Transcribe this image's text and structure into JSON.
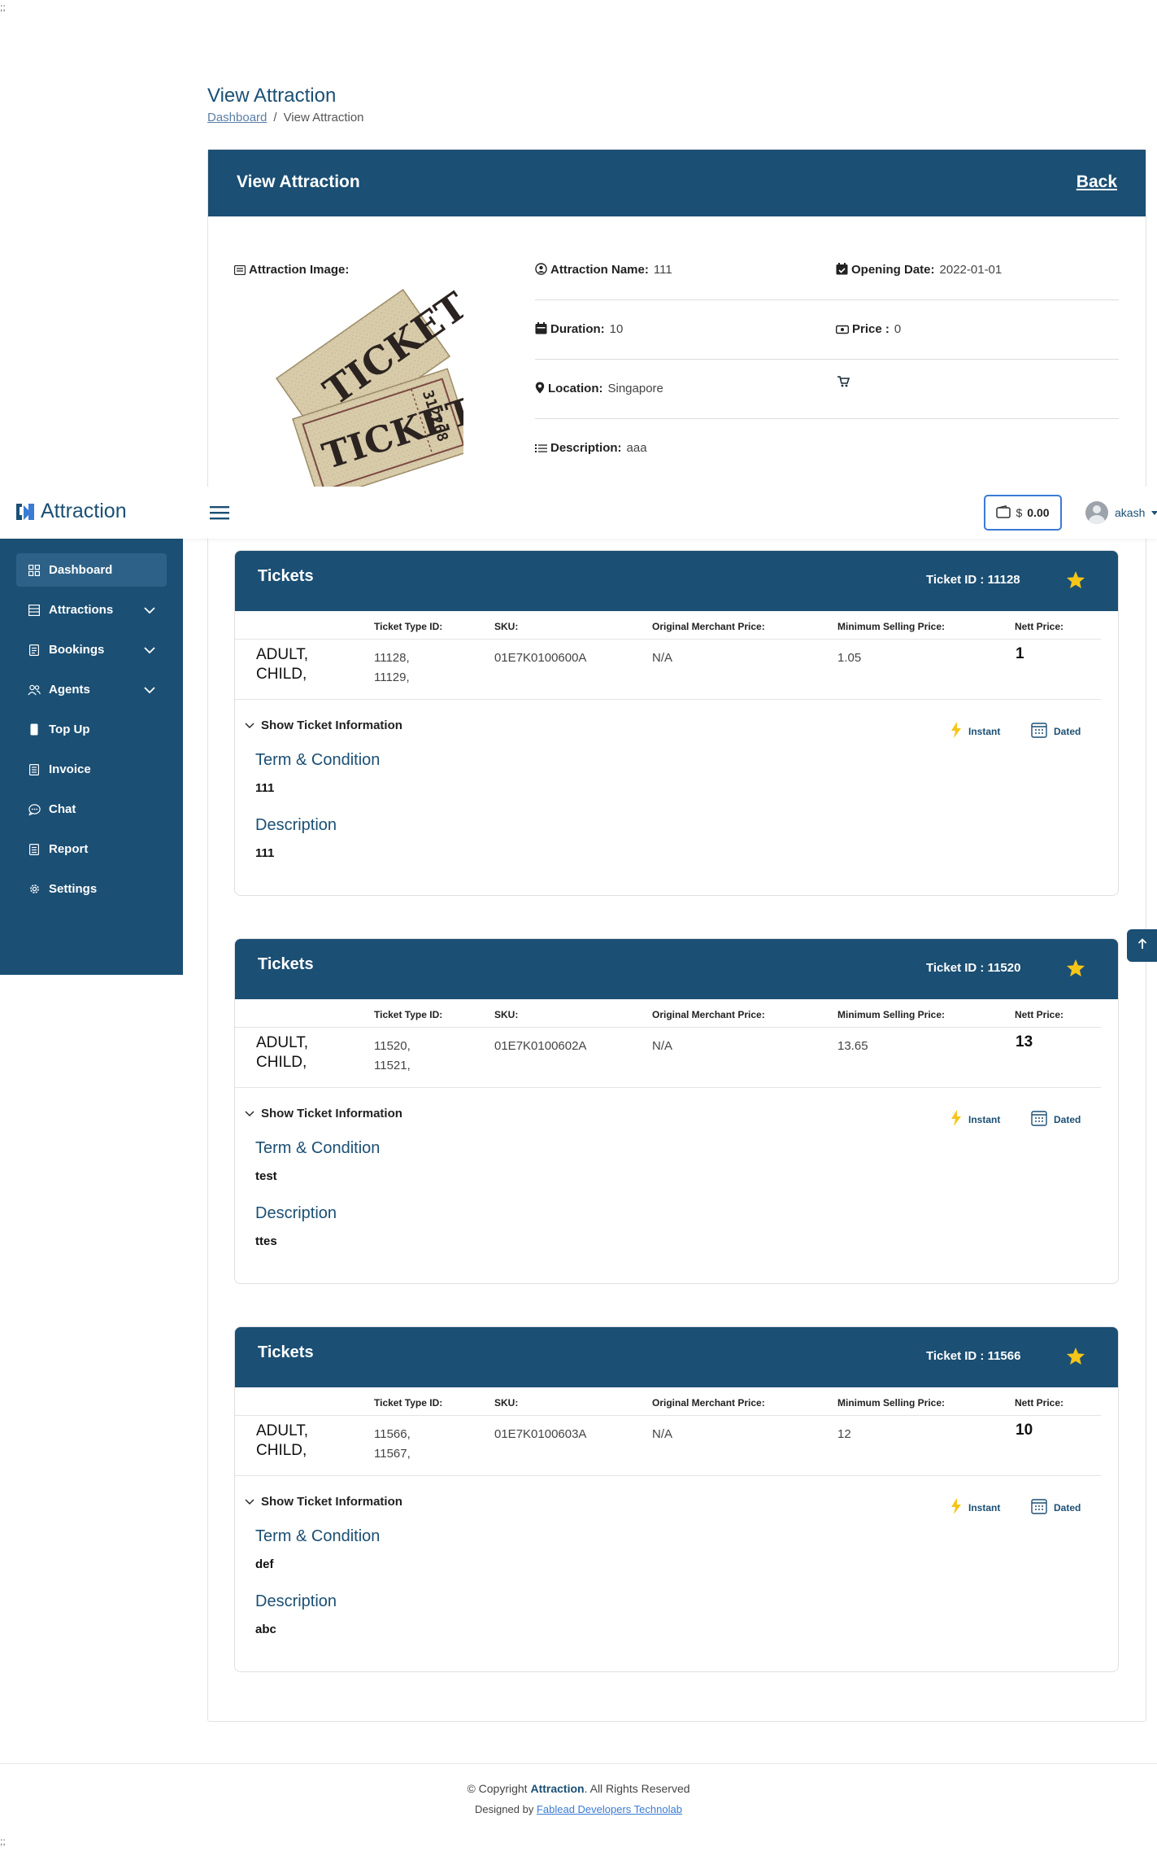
{
  "corner": {
    "top_left": ";;",
    "bottom_left": ";;"
  },
  "page": {
    "title": "View Attraction",
    "breadcrumb": {
      "home": "Dashboard",
      "separator": "/",
      "current": "View Attraction"
    }
  },
  "card": {
    "title": "View Attraction",
    "back_label": "Back"
  },
  "details": {
    "image_label": "Attraction Image:",
    "name_label": "Attraction Name:",
    "name_value": "111",
    "opening_label": "Opening Date:",
    "opening_value": "2022-01-01",
    "duration_label": "Duration:",
    "duration_value": "10",
    "price_label": "Price :",
    "price_value": "0",
    "location_label": "Location:",
    "location_value": "Singapore",
    "description_label": "Description:",
    "description_value": "aaa",
    "ticket_img_serial": "312268",
    "ticket_img_text": "TICKET"
  },
  "navbar": {
    "brand": "Attraction",
    "wallet_currency": "$",
    "wallet_amount": "0.00",
    "user": "akash"
  },
  "sidebar": {
    "items": [
      {
        "label": "Dashboard",
        "icon": "grid-icon"
      },
      {
        "label": "Attractions",
        "icon": "list-icon"
      },
      {
        "label": "Bookings",
        "icon": "document-icon"
      },
      {
        "label": "Agents",
        "icon": "users-icon"
      },
      {
        "label": "Top Up",
        "icon": "mobile-icon"
      },
      {
        "label": "Invoice",
        "icon": "invoice-icon"
      },
      {
        "label": "Chat",
        "icon": "chat-icon"
      },
      {
        "label": "Report",
        "icon": "report-icon"
      },
      {
        "label": "Settings",
        "icon": "gear-icon"
      }
    ]
  },
  "tickets_common": {
    "title": "Tickets",
    "columns": [
      "Ticket Type ID:",
      "SKU:",
      "Original Merchant Price:",
      "Minimum Selling Price:",
      "Nett Price:"
    ],
    "show_info": "Show Ticket Information",
    "instant": "Instant",
    "dated": "Dated",
    "term_title": "Term & Condition",
    "desc_title": "Description"
  },
  "tickets": [
    {
      "ticket_id": "Ticket ID : 11128",
      "type_line1": "ADULT,",
      "type_line2": "CHILD,",
      "id_line1": "11128,",
      "id_line2": "11129,",
      "sku": "01E7K0100600A",
      "merchant_price": "N/A",
      "min_price": "1.05",
      "nett": "1",
      "term": "111",
      "description": "111"
    },
    {
      "ticket_id": "Ticket ID : 11520",
      "type_line1": "ADULT,",
      "type_line2": "CHILD,",
      "id_line1": "11520,",
      "id_line2": "11521,",
      "sku": "01E7K0100602A",
      "merchant_price": "N/A",
      "min_price": "13.65",
      "nett": "13",
      "term": "test",
      "description": "ttes"
    },
    {
      "ticket_id": "Ticket ID : 11566",
      "type_line1": "ADULT,",
      "type_line2": "CHILD,",
      "id_line1": "11566,",
      "id_line2": "11567,",
      "sku": "01E7K0100603A",
      "merchant_price": "N/A",
      "min_price": "12",
      "nett": "10",
      "term": "def",
      "description": "abc"
    }
  ],
  "footer": {
    "copyright_prefix": "© Copyright",
    "copyright_brand": "Attraction",
    "copyright_suffix": ". All Rights Reserved",
    "designed_prefix": "Designed by",
    "designed_link": "Fablead Developers Technolab"
  }
}
